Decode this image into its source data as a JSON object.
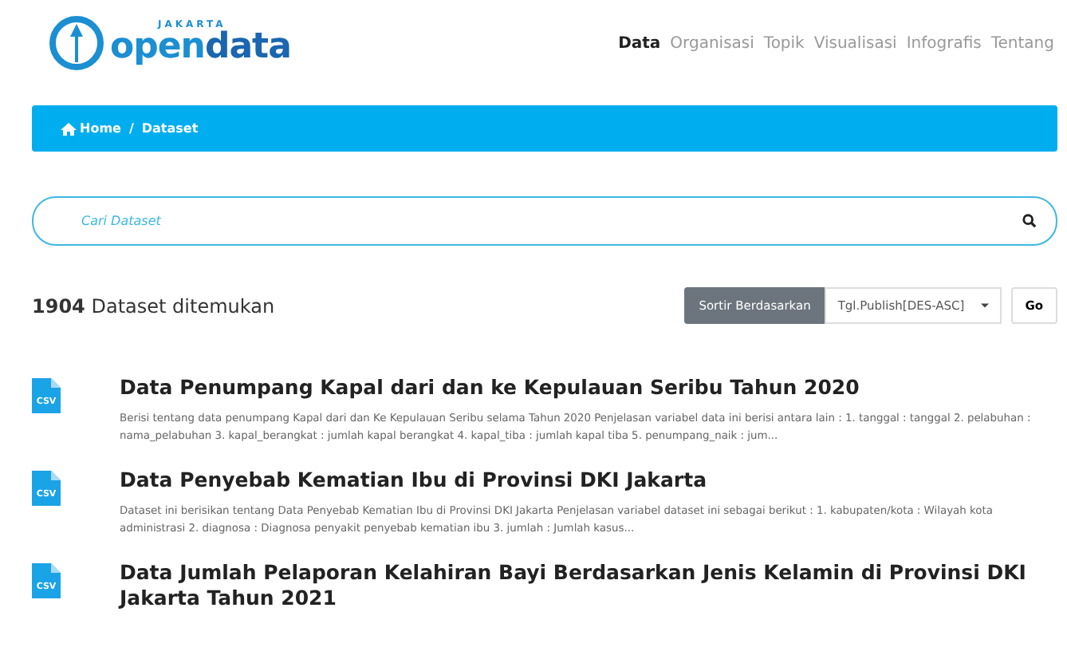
{
  "logo": {
    "top": "JAKARTA",
    "main_a": "open",
    "main_b": "data"
  },
  "nav": [
    {
      "label": "Data",
      "selected": true
    },
    {
      "label": "Organisasi",
      "selected": false
    },
    {
      "label": "Topik",
      "selected": false
    },
    {
      "label": "Visualisasi",
      "selected": false
    },
    {
      "label": "Infografis",
      "selected": false
    },
    {
      "label": "Tentang",
      "selected": false
    }
  ],
  "breadcrumb": {
    "home": "Home",
    "separator": "/",
    "current": "Dataset"
  },
  "search": {
    "placeholder": "Cari Dataset"
  },
  "results": {
    "count": "1904",
    "label": "Dataset ditemukan"
  },
  "sort": {
    "label": "Sortir Berdasarkan",
    "value": "Tgl.Publish[DES-ASC]",
    "go": "Go"
  },
  "datasets": [
    {
      "format": "CSV",
      "title": "Data Penumpang Kapal dari dan ke Kepulauan Seribu Tahun 2020",
      "description": "Berisi tentang data penumpang Kapal dari dan Ke Kepulauan Seribu selama Tahun 2020 Penjelasan variabel data ini berisi antara lain : 1. tanggal : tanggal 2. pelabuhan : nama_pelabuhan 3. kapal_berangkat : jumlah kapal berangkat 4. kapal_tiba : jumlah kapal tiba 5. penumpang_naik : jum..."
    },
    {
      "format": "CSV",
      "title": "Data Penyebab Kematian Ibu di Provinsi DKI Jakarta",
      "description": "Dataset ini berisikan tentang Data Penyebab Kematian Ibu di Provinsi DKI Jakarta Penjelasan variabel dataset ini sebagai berikut : 1. kabupaten/kota : Wilayah kota administrasi 2. diagnosa : Diagnosa penyakit penyebab kematian ibu 3. jumlah : Jumlah kasus..."
    },
    {
      "format": "CSV",
      "title": "Data Jumlah Pelaporan Kelahiran Bayi Berdasarkan Jenis Kelamin di Provinsi DKI Jakarta Tahun 2021"
    }
  ]
}
